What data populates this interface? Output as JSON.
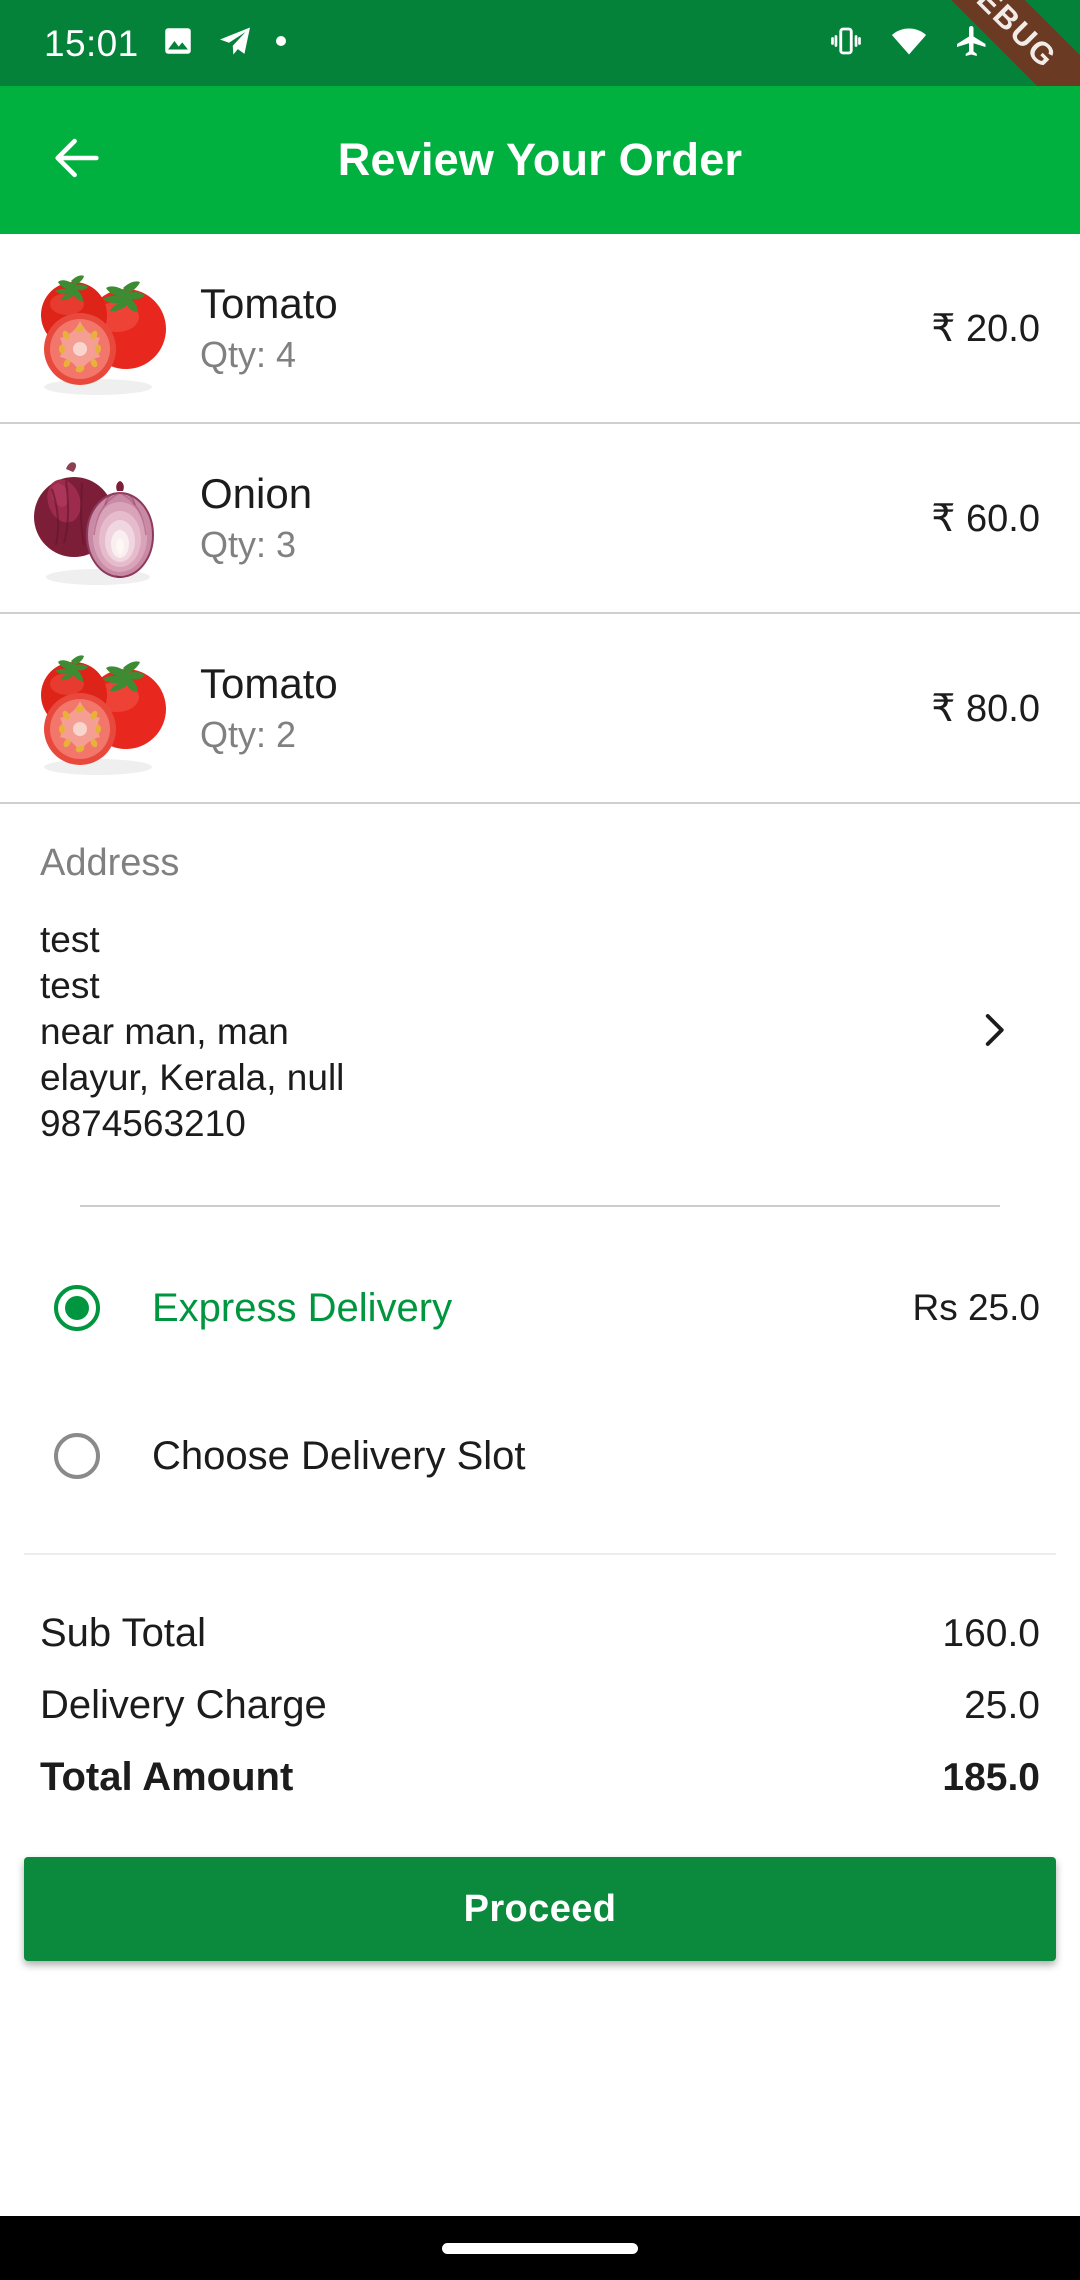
{
  "status_bar": {
    "time": "15:01",
    "left_icons": [
      "image-icon",
      "telegram-icon",
      "dot-icon"
    ],
    "right_icons": [
      "vibrate-icon",
      "wifi-icon",
      "airplane-mode-icon",
      "battery-icon"
    ],
    "background_color": "#04823a"
  },
  "debug_ribbon": {
    "label": "DEBUG",
    "color": "#6b3a23"
  },
  "app_bar": {
    "title": "Review Your Order",
    "back_icon": "arrow-left-icon",
    "background_color": "#00b140"
  },
  "items": [
    {
      "name": "Tomato",
      "qty_label": "Qty: 4",
      "price": "₹ 20.0",
      "image": "tomato-image"
    },
    {
      "name": "Onion",
      "qty_label": "Qty: 3",
      "price": "₹ 60.0",
      "image": "onion-image"
    },
    {
      "name": "Tomato",
      "qty_label": "Qty: 2",
      "price": "₹ 80.0",
      "image": "tomato-image"
    }
  ],
  "address": {
    "label": "Address",
    "lines": [
      "test",
      "test",
      "near man, man",
      "elayur, Kerala, null",
      "9874563210"
    ],
    "chevron_icon": "chevron-right-icon"
  },
  "delivery": {
    "options": [
      {
        "label": "Express Delivery",
        "price": "Rs 25.0",
        "selected": true
      },
      {
        "label": "Choose Delivery Slot",
        "price": "",
        "selected": false
      }
    ],
    "selected_color": "#00963f"
  },
  "totals": [
    {
      "label": "Sub Total",
      "value": "160.0",
      "bold": false
    },
    {
      "label": "Delivery Charge",
      "value": "25.0",
      "bold": false
    },
    {
      "label": "Total Amount",
      "value": "185.0",
      "bold": true
    }
  ],
  "proceed": {
    "label": "Proceed",
    "color": "#0b8a3d"
  },
  "nav_bar": {
    "handle": "gesture-handle"
  }
}
